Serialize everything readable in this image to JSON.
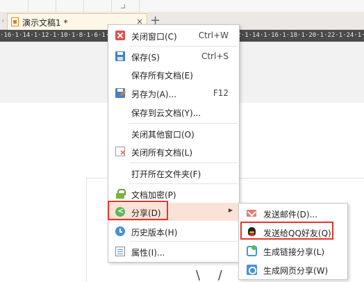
{
  "tab": {
    "title": "演示文稿1 *",
    "close": "×",
    "add": "+",
    "scroll_arrow": "‹"
  },
  "ruler": {
    "ticks": "·16·1·14·1·12·1·10·1·8·1·6·1·4·1·2·1·0·1·2·1·4·1·6·1·8·1·10·1·12·1·14·1·16·1·18·1·20·1·22·1·24·1·26·1"
  },
  "menu": {
    "items": [
      {
        "label": "关闭窗口(C)",
        "shortcut": "Ctrl+W",
        "icon": "close-window-icon"
      },
      {
        "label": "保存(S)",
        "shortcut": "Ctrl+S",
        "icon": "save-icon"
      },
      {
        "label": "保存所有文档(E)",
        "shortcut": ""
      },
      {
        "label": "另存为(A)...",
        "shortcut": "F12",
        "icon": "save-as-icon"
      },
      {
        "label": "保存到云文档(Y)...",
        "shortcut": ""
      },
      {
        "label": "关闭其他窗口(O)",
        "shortcut": ""
      },
      {
        "label": "关闭所有文档(L)",
        "shortcut": "",
        "icon": "close-all-icon"
      },
      {
        "label": "打开所在文件夹(F)",
        "shortcut": ""
      },
      {
        "label": "文档加密(P)",
        "shortcut": "",
        "icon": "lock-icon"
      },
      {
        "label": "分享(D)",
        "shortcut": "",
        "icon": "share-icon",
        "has_submenu": true
      },
      {
        "label": "历史版本(H)",
        "shortcut": "",
        "icon": "history-icon"
      },
      {
        "label": "属性(I)...",
        "shortcut": "",
        "icon": "properties-icon"
      }
    ],
    "submenu_arrow": "▶"
  },
  "submenu": {
    "items": [
      {
        "label": "发送邮件(D)...",
        "icon": "mail-icon"
      },
      {
        "label": "发送给QQ好友(Q)",
        "icon": "qq-icon"
      },
      {
        "label": "生成链接分享(L)",
        "icon": "link-icon"
      },
      {
        "label": "生成网页分享(W)",
        "icon": "web-icon"
      }
    ]
  },
  "colors": {
    "highlight_outline": "#e8322c",
    "active_item_bg": "#fbe2d6",
    "ruler_bg": "#4a4a4a"
  }
}
